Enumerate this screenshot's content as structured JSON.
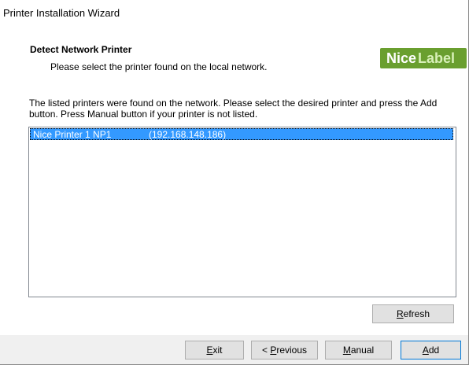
{
  "window": {
    "title": "Printer Installation Wizard"
  },
  "header": {
    "heading": "Detect Network Printer",
    "subheading": "Please select the printer found on the local network.",
    "logo": {
      "part1": "Nice",
      "part2": "Label"
    }
  },
  "main": {
    "description": "The listed printers were found on the network. Please select the desired printer and press the Add button. Press Manual button if your printer is not listed.",
    "printers": [
      {
        "name": "Nice Printer 1 NP1",
        "ip": "(192.168.148.186)",
        "selected": true
      }
    ],
    "refresh_prefix": "",
    "refresh_key": "R",
    "refresh_rest": "efresh"
  },
  "footer": {
    "exit_key": "E",
    "exit_rest": "xit",
    "previous_prefix": "< ",
    "previous_key": "P",
    "previous_rest": "revious",
    "manual_key": "M",
    "manual_rest": "anual",
    "add_key": "A",
    "add_rest": "dd"
  },
  "colors": {
    "selection": "#3399ff",
    "logo_green": "#6a9f2f",
    "default_border": "#0078d7"
  }
}
